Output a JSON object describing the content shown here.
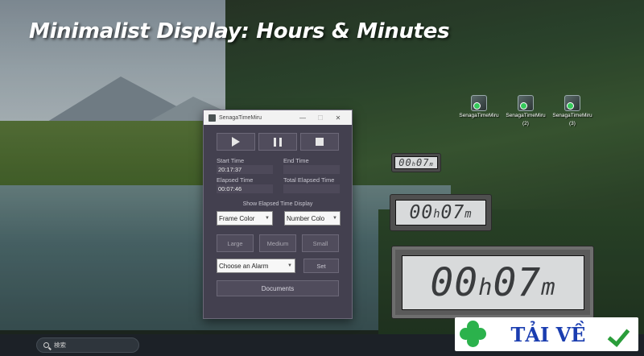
{
  "headline": "Minimalist Display: Hours & Minutes",
  "desktop_icons": [
    {
      "label": "SenagaTimeMiru",
      "sub": ""
    },
    {
      "label": "SenagaTimeMiru",
      "sub": "(2)"
    },
    {
      "label": "SenagaTimeMiru",
      "sub": "(3)"
    }
  ],
  "window": {
    "title": "SenagaTimeMiru",
    "minimize": "—",
    "maximize": "☐",
    "close": "✕",
    "start_time_label": "Start Time",
    "start_time_value": "20:17:37",
    "end_time_label": "End Time",
    "end_time_value": "",
    "elapsed_time_label": "Elapsed Time",
    "elapsed_time_value": "00:07:46",
    "total_elapsed_label": "Total Elapsed Time",
    "total_elapsed_value": "",
    "display_caption": "Show Elapsed Time Display",
    "frame_color": "Frame Color",
    "number_color": "Number Colo",
    "size_large": "Large",
    "size_medium": "Medium",
    "size_small": "Small",
    "alarm_select": "Choose an Alarm",
    "set_button": "Set",
    "documents_button": "Documents"
  },
  "lcd_displays": [
    {
      "hours": "00",
      "h": "h",
      "minutes": "07",
      "m": "m"
    },
    {
      "hours": "00",
      "h": "h",
      "minutes": "07",
      "m": "m"
    },
    {
      "hours": "00",
      "h": "h",
      "minutes": "07",
      "m": "m"
    }
  ],
  "taskbar": {
    "search_placeholder": "検索"
  },
  "watermark": {
    "text": "TẢI VỀ"
  },
  "colors": {
    "window_bg": "#43404f",
    "button_bg": "#504c5c",
    "lcd_face": "#d8dadb",
    "watermark_text": "#1a3db0",
    "watermark_green": "#2bb24c"
  }
}
